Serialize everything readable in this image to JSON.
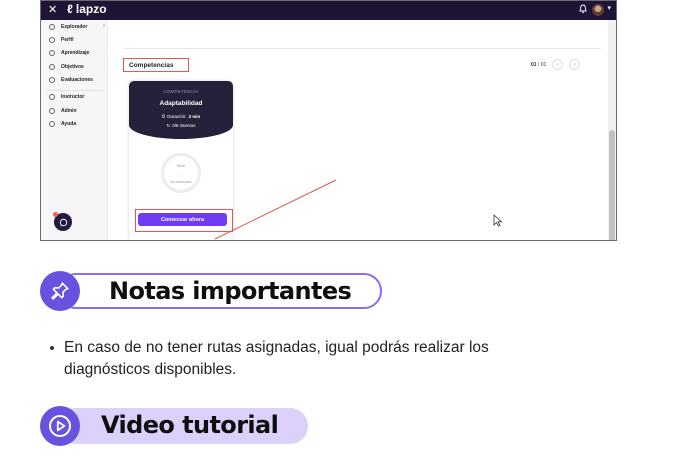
{
  "app": {
    "brand": "lapzo",
    "sidebar": [
      {
        "label": "Explorador"
      },
      {
        "label": "Perfil"
      },
      {
        "label": "Aprendizaje"
      },
      {
        "label": "Objetivos"
      },
      {
        "label": "Evaluaciones"
      },
      {
        "label": "Instructor"
      },
      {
        "label": "Admin"
      },
      {
        "label": "Ayuda"
      }
    ],
    "section_title": "Competencias",
    "pager": {
      "current": "01",
      "separator": "/",
      "total": "01"
    },
    "card": {
      "kicker": "COMPETENCIA",
      "name": "Adaptabilidad",
      "duration_label": "Duración:",
      "duration_value": "3 min",
      "attempts": "0/6 intentos",
      "level_label": "Nivel",
      "level_value": "---",
      "level_status": "No evaluado",
      "cta": "Comenzar ahora"
    },
    "colors": {
      "topbar": "#201436",
      "cta": "#6f3bf5",
      "highlight": "#e25656"
    }
  },
  "notes": {
    "title": "Notas importantes",
    "icon": "pin-icon",
    "items": [
      "En caso de no tener rutas asignadas, igual podrás realizar los diagnósticos disponibles."
    ]
  },
  "video": {
    "title": "Video tutorial",
    "icon": "play-icon"
  },
  "colors": {
    "accent": "#6a52e0",
    "notes_border": "#8d6bf2",
    "video_pill": "#dcd1fb"
  }
}
